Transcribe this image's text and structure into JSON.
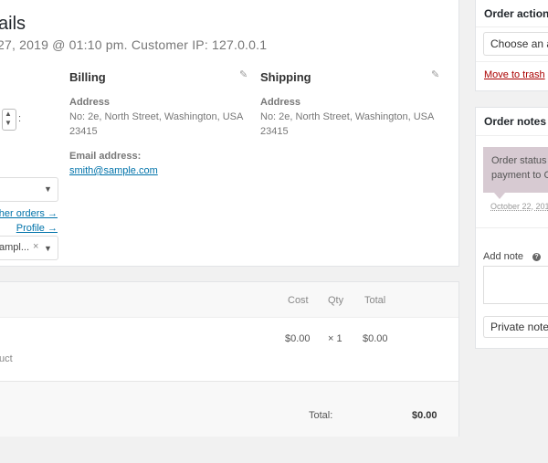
{
  "order": {
    "title_fragment": "ails",
    "meta_line": "27, 2019 @ 01:10 pm. Customer IP: 127.0.0.1",
    "customer_select_value": "ampl...",
    "links": {
      "other_orders": "other orders →",
      "profile": "Profile →"
    }
  },
  "billing": {
    "heading": "Billing",
    "address_label": "Address",
    "address_lines": [
      "No: 2e, North Street, Washington, USA",
      "23415"
    ],
    "email_label": "Email address:",
    "email": "smith@sample.com"
  },
  "shipping": {
    "heading": "Shipping",
    "address_label": "Address",
    "address_lines": [
      "No: 2e, North Street, Washington, USA",
      "23415"
    ]
  },
  "items": {
    "columns": {
      "cost": "Cost",
      "qty": "Qty",
      "total": "Total"
    },
    "row": {
      "product_fragment": "uct",
      "cost": "$0.00",
      "qty": "× 1",
      "total": "$0.00"
    },
    "total_label": "Total:",
    "total_value": "$0.00"
  },
  "sidebar": {
    "order_actions": {
      "title": "Order actions",
      "select_value": "Choose an a",
      "trash_link": "Move to trash"
    },
    "order_notes": {
      "title": "Order notes",
      "note_lines": [
        "Order status c",
        "payment to C"
      ],
      "note_date": "October 22, 201",
      "add_note_label": "Add note",
      "help_icon": "?",
      "note_type_value": "Private note"
    }
  },
  "colors": {
    "link": "#0073aa",
    "trash": "#a00",
    "note_bg": "#d7cad2"
  }
}
